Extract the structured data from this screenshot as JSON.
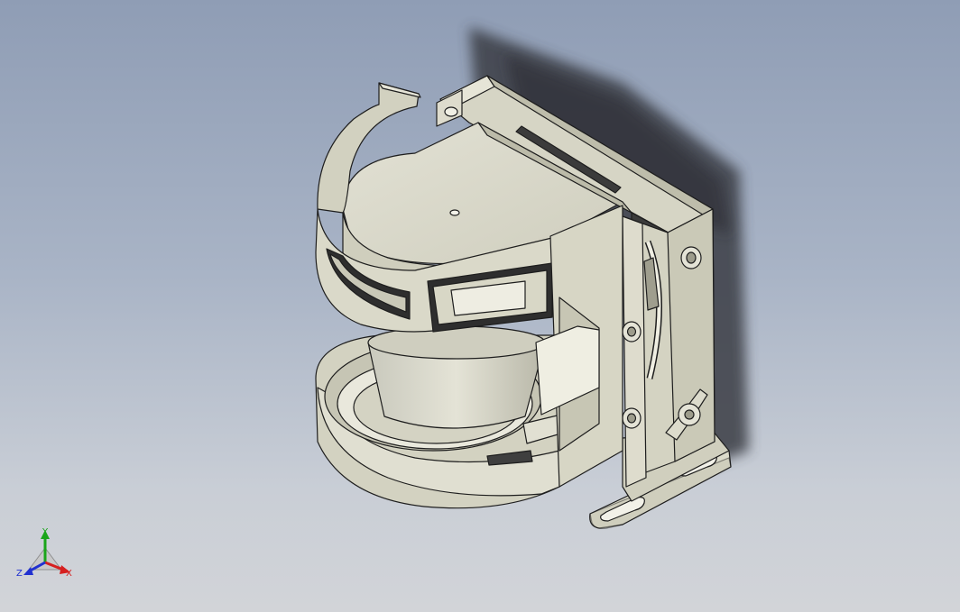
{
  "scene": {
    "model": "laser-scanner-with-mounting-bracket",
    "colors": {
      "background_top": "#8f9db5",
      "background_bottom": "#d2d4d8",
      "part_face": "#d9d8c8",
      "part_face_light": "#e6e5d7",
      "part_face_dark": "#b9b8a6",
      "edge": "#1e1e1e",
      "shadow": "#3a3d44"
    }
  },
  "triad": {
    "x_label": "X",
    "y_label": "Y",
    "z_label": "Z",
    "x_color": "#d62020",
    "y_color": "#1aa51a",
    "z_color": "#2030d0"
  }
}
